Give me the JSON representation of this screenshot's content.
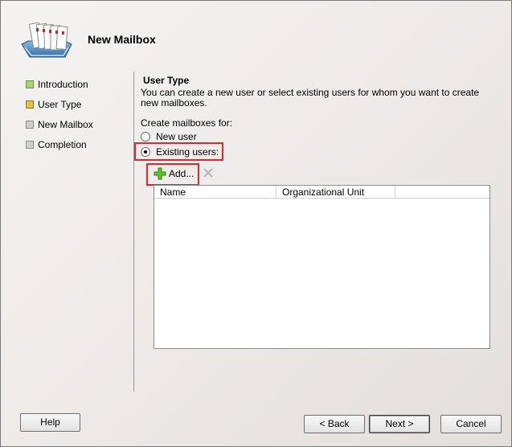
{
  "window": {
    "title": "New Mailbox"
  },
  "steps": [
    {
      "label": "Introduction",
      "state": "done"
    },
    {
      "label": "User Type",
      "state": "current"
    },
    {
      "label": "New Mailbox",
      "state": "pending"
    },
    {
      "label": "Completion",
      "state": "pending"
    }
  ],
  "section": {
    "title": "User Type",
    "description": "You can create a new user or select existing users for whom you want to create new mailboxes."
  },
  "create_for": {
    "label": "Create mailboxes for:",
    "options": [
      {
        "label": "New user",
        "selected": false
      },
      {
        "label": "Existing users:",
        "selected": true
      }
    ]
  },
  "toolbar": {
    "add_label": "Add..."
  },
  "list": {
    "columns": [
      "Name",
      "Organizational Unit"
    ],
    "rows": []
  },
  "buttons": {
    "help": "Help",
    "back": "< Back",
    "next": "Next >",
    "cancel": "Cancel"
  },
  "colors": {
    "highlight": "#e0262e",
    "step_done": "#a9d76e",
    "step_current": "#e6c23a",
    "step_pending": "#cfcfcf"
  },
  "icons": {
    "header": "mailbox-stack-icon",
    "add": "green-plus-icon",
    "remove": "remove-x-icon"
  }
}
